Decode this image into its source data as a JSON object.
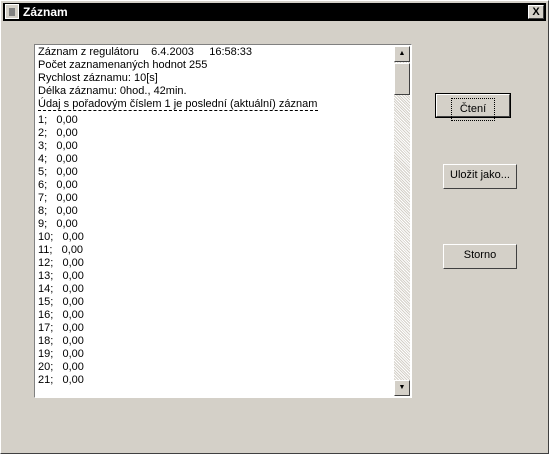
{
  "window": {
    "title": "Záznam",
    "close_label": "X"
  },
  "listbox": {
    "header": [
      "Záznam z regulátoru    6.4.2003     16:58:33",
      "Počet zaznamenaných hodnot 255",
      "Rychlost záznamu: 10[s]",
      "Délka záznamu: 0hod., 42min.",
      "Údaj s pořadovým číslem 1 je poslední (aktuální) záznam"
    ],
    "rows": [
      "1;   0,00",
      "2;   0,00",
      "3;   0,00",
      "4;   0,00",
      "5;   0,00",
      "6;   0,00",
      "7;   0,00",
      "8;   0,00",
      "9;   0,00",
      "10;   0,00",
      "11;   0,00",
      "12;   0,00",
      "13;   0,00",
      "14;   0,00",
      "15;   0,00",
      "16;   0,00",
      "17;   0,00",
      "18;   0,00",
      "19;   0,00",
      "20;   0,00",
      "21;   0,00"
    ]
  },
  "buttons": {
    "read": "Čtení",
    "save_as": "Uložit jako...",
    "cancel": "Storno"
  }
}
